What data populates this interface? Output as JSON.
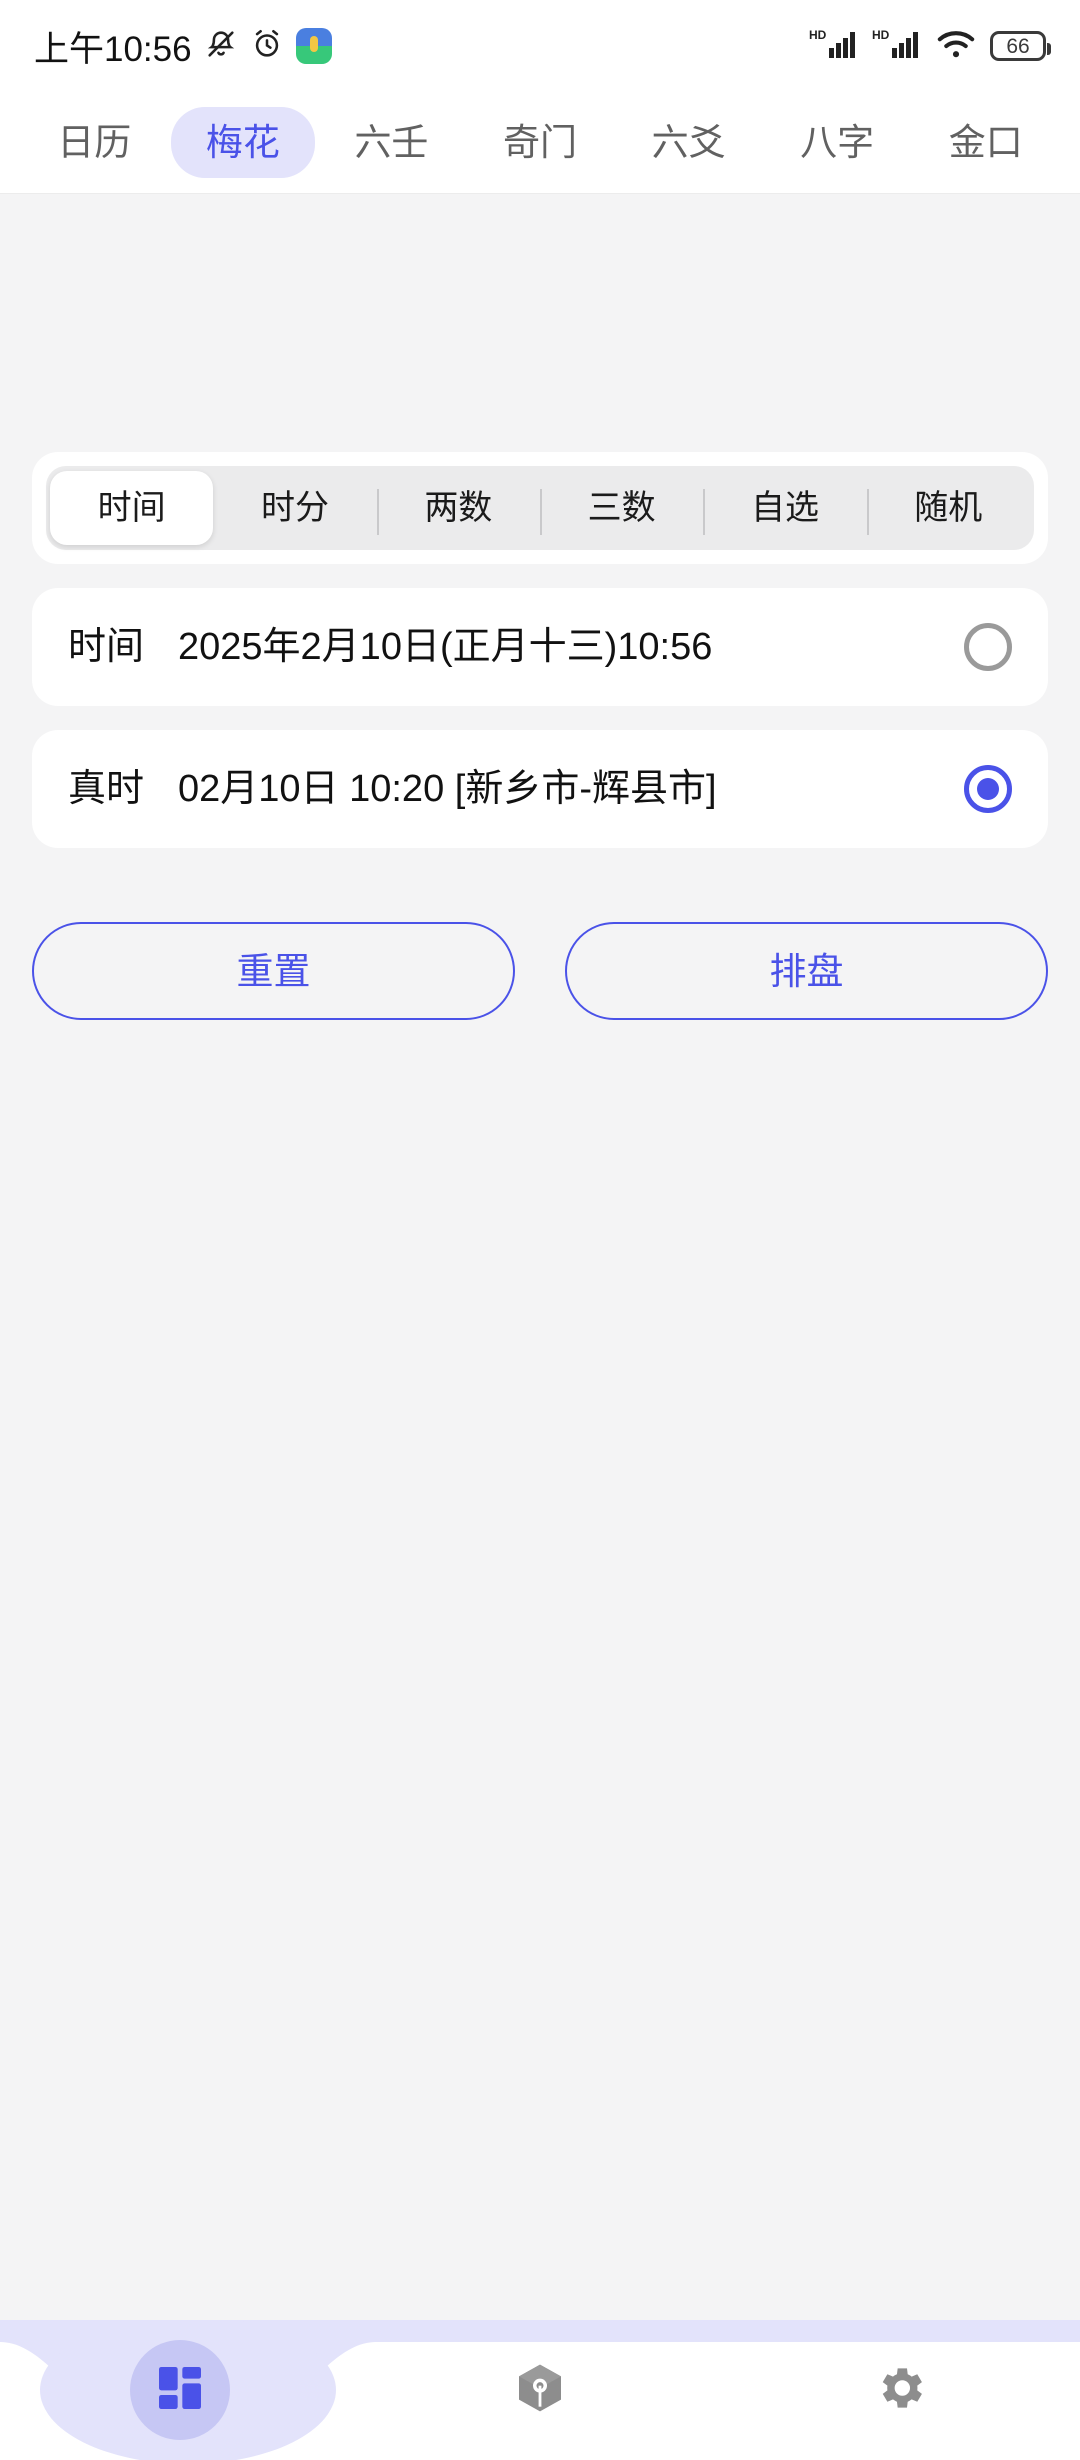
{
  "status_bar": {
    "clock": "上午10:56",
    "icons_left": [
      "mute-icon",
      "alarm-icon",
      "app-badge-icon"
    ],
    "network_label_1": "HD",
    "network_label_2": "HD",
    "icons_right": [
      "signal-bars-icon",
      "signal-bars-icon",
      "wifi-icon",
      "battery-icon"
    ],
    "battery_level": "66"
  },
  "top_tabs": {
    "active_index": 1,
    "items": [
      {
        "label": "日历"
      },
      {
        "label": "梅花"
      },
      {
        "label": "六壬"
      },
      {
        "label": "奇门"
      },
      {
        "label": "六爻"
      },
      {
        "label": "八字"
      },
      {
        "label": "金口"
      }
    ]
  },
  "segment": {
    "active_index": 0,
    "items": [
      {
        "label": "时间"
      },
      {
        "label": "时分"
      },
      {
        "label": "两数"
      },
      {
        "label": "三数"
      },
      {
        "label": "自选"
      },
      {
        "label": "随机"
      }
    ]
  },
  "rows": [
    {
      "label": "时间",
      "value": "2025年2月10日(正月十三)10:56",
      "selected": false
    },
    {
      "label": "真时",
      "value": "02月10日 10:20 [新乡市-辉县市]",
      "selected": true
    }
  ],
  "actions": {
    "reset_label": "重置",
    "paipan_label": "排盘"
  },
  "bottom_nav": {
    "active_index": 0,
    "items": [
      {
        "icon": "grid-icon"
      },
      {
        "icon": "cube-icon"
      },
      {
        "icon": "gear-icon"
      }
    ]
  },
  "colors": {
    "accent": "#4a52e8",
    "accent_soft": "#e3e3fb",
    "page_bg": "#f4f4f5",
    "card_bg": "#ffffff",
    "segment_track": "#ebebec",
    "radio_off": "#9a9a9a",
    "nav_inactive": "#8d8d8d"
  }
}
